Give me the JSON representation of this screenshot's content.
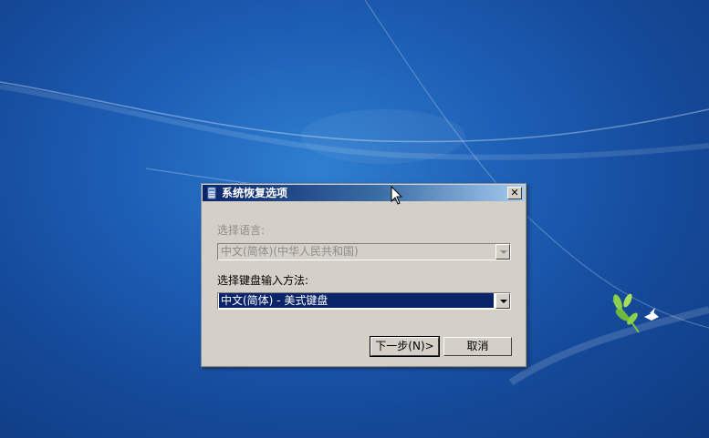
{
  "dialog": {
    "title": "系统恢复选项",
    "close_label": "✕",
    "language_label": "选择语言:",
    "language_value": "中文(简体)(中华人民共和国)",
    "keyboard_label": "选择键盘输入方法:",
    "keyboard_value": "中文(简体) - 美式键盘",
    "next_button": "下一步(N)>",
    "cancel_button": "取消"
  },
  "icons": {
    "title_icon": "recovery-tool-icon",
    "close": "close-icon",
    "dropdown": "chevron-down-icon",
    "pointer": "mouse-pointer-icon",
    "wallpaper_logo": "leaf-bird-logo"
  },
  "colors": {
    "desktop_blue": "#1d5fb6",
    "title_bar_start": "#0a246a",
    "title_bar_end": "#a6caf0",
    "dialog_face": "#d4d0c8",
    "selection": "#0a246a",
    "disabled_text": "#8c8c8c"
  }
}
